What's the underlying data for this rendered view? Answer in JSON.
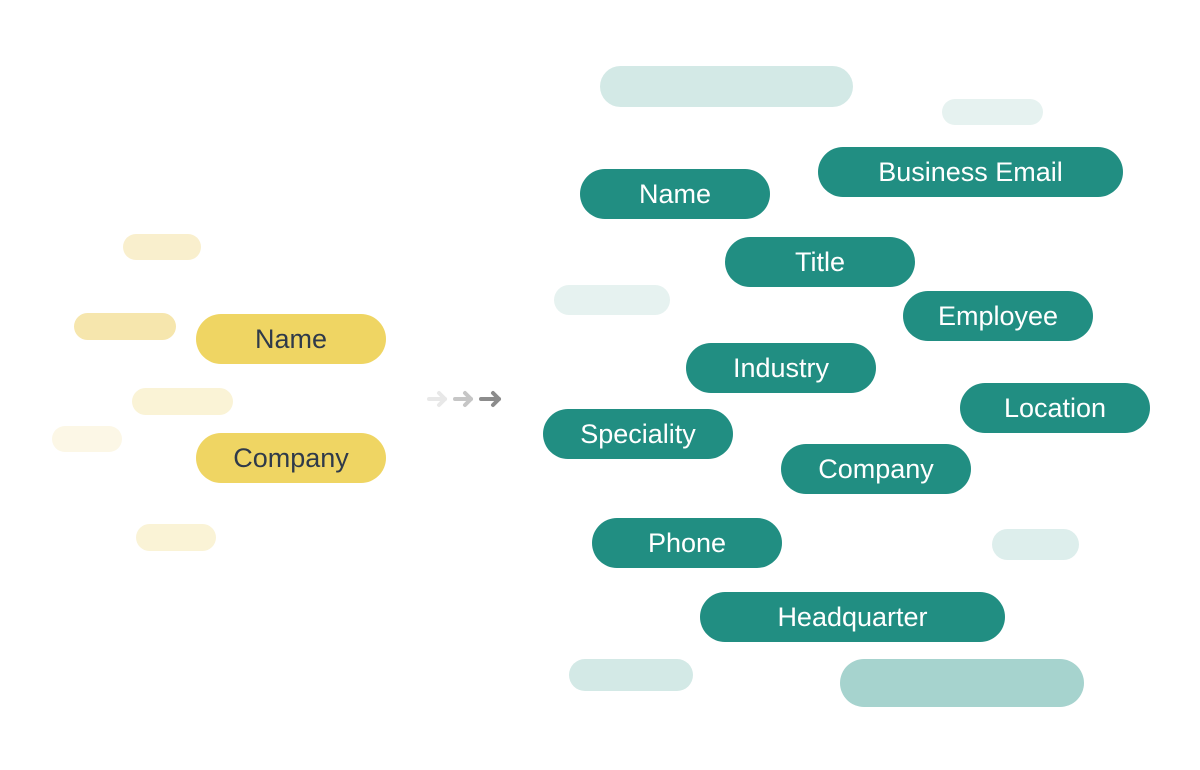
{
  "source": {
    "fields": [
      {
        "label": "Name"
      },
      {
        "label": "Company"
      }
    ]
  },
  "arrow": {
    "icon": "triple-arrow-right",
    "count": 3
  },
  "enriched": {
    "fields": [
      {
        "label": "Name"
      },
      {
        "label": "Business Email"
      },
      {
        "label": "Title"
      },
      {
        "label": "Employee"
      },
      {
        "label": "Industry"
      },
      {
        "label": "Location"
      },
      {
        "label": "Speciality"
      },
      {
        "label": "Company"
      },
      {
        "label": "Phone"
      },
      {
        "label": "Headquarter"
      }
    ]
  },
  "colors": {
    "source_pill": "#efd563",
    "source_text": "#2f3a4a",
    "enriched_pill": "#218e82",
    "enriched_text": "#ffffff",
    "arrow_light": "#e6e6e6",
    "arrow_mid": "#c4c4c4",
    "arrow_dark": "#8a8a8a"
  }
}
